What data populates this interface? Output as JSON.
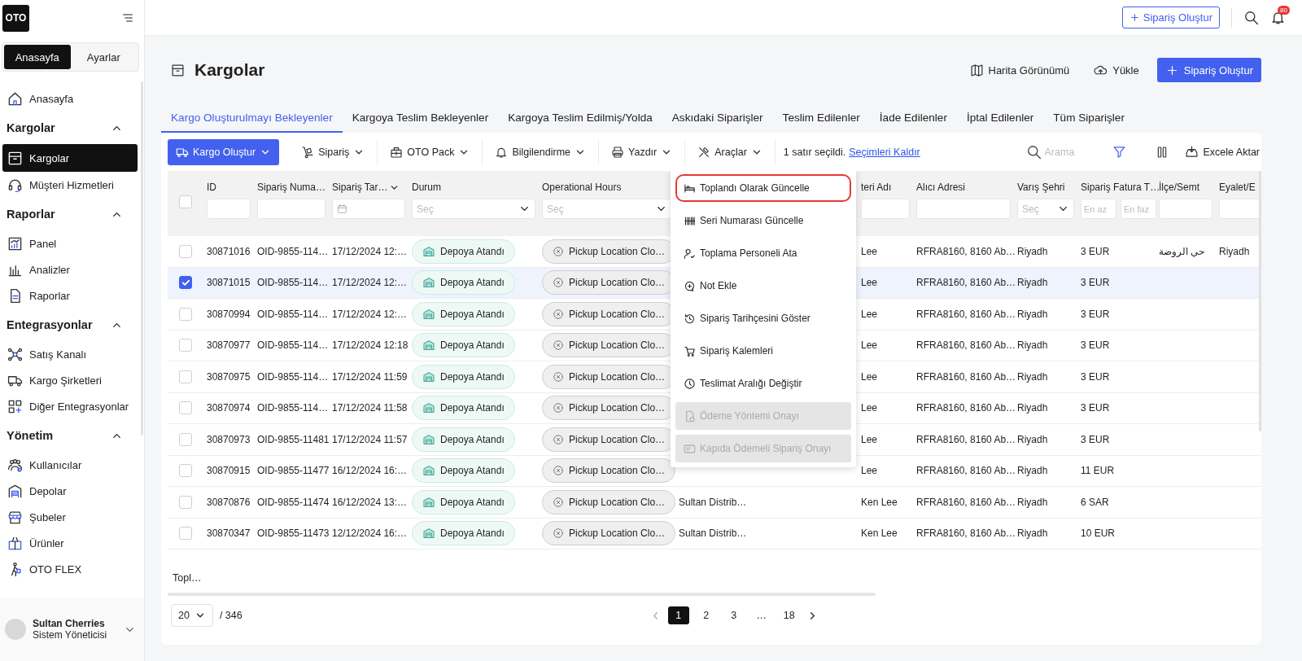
{
  "sidebar": {
    "logo": "OTO",
    "tabs": [
      {
        "label": "Anasayfa",
        "selected": true
      },
      {
        "label": "Ayarlar",
        "selected": false
      }
    ],
    "nav": [
      {
        "kind": "item",
        "label": "Anasayfa",
        "selected": false
      },
      {
        "kind": "group",
        "label": "Kargolar",
        "expanded": true,
        "children": [
          {
            "label": "Kargolar",
            "selected": true
          },
          {
            "label": "Müşteri Hizmetleri",
            "selected": false
          }
        ]
      },
      {
        "kind": "group",
        "label": "Raporlar",
        "expanded": true,
        "children": [
          {
            "label": "Panel",
            "selected": false
          },
          {
            "label": "Analizler",
            "selected": false
          },
          {
            "label": "Raporlar",
            "selected": false
          }
        ]
      },
      {
        "kind": "group",
        "label": "Entegrasyonlar",
        "expanded": true,
        "children": [
          {
            "label": "Satış Kanalı",
            "selected": false
          },
          {
            "label": "Kargo Şirketleri",
            "selected": false
          },
          {
            "label": "Diğer Entegrasyonlar",
            "selected": false
          }
        ]
      },
      {
        "kind": "group",
        "label": "Yönetim",
        "expanded": true,
        "children": [
          {
            "label": "Kullanıcılar",
            "selected": false
          },
          {
            "label": "Depolar",
            "selected": false
          },
          {
            "label": "Şubeler",
            "selected": false
          },
          {
            "label": "Ürünler",
            "selected": false
          },
          {
            "label": "OTO FLEX",
            "selected": false
          }
        ]
      }
    ],
    "user": {
      "name": "Sultan Cherries",
      "role": "Sistem Yöneticisi"
    }
  },
  "topbar": {
    "create_button": "Sipariş Oluştur",
    "notification_count": "80"
  },
  "page": {
    "title": "Kargolar",
    "actions": [
      {
        "kind": "link",
        "label": "Harita Görünümü"
      },
      {
        "kind": "link",
        "label": "Yükle"
      },
      {
        "kind": "primary",
        "label": "Sipariş Oluştur"
      }
    ]
  },
  "tabs": [
    {
      "label": "Kargo Oluşturulmayı Bekleyenler",
      "selected": true
    },
    {
      "label": "Kargoya Teslim Bekleyenler",
      "selected": false
    },
    {
      "label": "Kargoya Teslim Edilmiş/Yolda",
      "selected": false
    },
    {
      "label": "Askıdaki Siparişler",
      "selected": false
    },
    {
      "label": "Teslim Edilenler",
      "selected": false
    },
    {
      "label": "İade Edilenler",
      "selected": false
    },
    {
      "label": "İptal Edilenler",
      "selected": false
    },
    {
      "label": "Tüm Siparişler",
      "selected": false
    }
  ],
  "toolbar": {
    "menus": [
      {
        "kind": "primary",
        "label": "Kargo Oluştur"
      },
      {
        "kind": "plain",
        "label": "Sipariş"
      },
      {
        "kind": "plain",
        "label": "OTO Pack"
      },
      {
        "kind": "plain",
        "label": "Bilgilendirme"
      },
      {
        "kind": "plain",
        "label": "Yazdır"
      },
      {
        "kind": "plain",
        "label": "Araçlar"
      }
    ],
    "selection_info": "1 satır seçildi.",
    "clear_link": "Seçimleri Kaldır",
    "search": {
      "placeholder": "Arama"
    },
    "export_button": "Excele Aktar"
  },
  "actions_menu": {
    "items": [
      {
        "label": "Toplandı Olarak Güncelle",
        "highlighted": true,
        "disabled": false
      },
      {
        "label": "Seri Numarası Güncelle",
        "highlighted": false,
        "disabled": false
      },
      {
        "label": "Toplama Personeli Ata",
        "highlighted": false,
        "disabled": false
      },
      {
        "label": "Not Ekle",
        "highlighted": false,
        "disabled": false
      },
      {
        "label": "Sipariş Tarihçesini Göster",
        "highlighted": false,
        "disabled": false
      },
      {
        "label": "Sipariş Kalemleri",
        "highlighted": false,
        "disabled": false
      },
      {
        "label": "Teslimat Aralığı Değiştir",
        "highlighted": false,
        "disabled": false
      },
      {
        "label": "Ödeme Yöntemi Onayı",
        "highlighted": false,
        "disabled": true
      },
      {
        "label": "Kapıda Ödemeli Sipariş Onayı",
        "highlighted": false,
        "disabled": true
      }
    ]
  },
  "table": {
    "select_all": {
      "checked": false
    },
    "columns": [
      {
        "label": "ID",
        "kind": "input"
      },
      {
        "label": "Sipariş Numa…",
        "kind": "input"
      },
      {
        "label": "Sipariş Tar…",
        "kind": "date"
      },
      {
        "label": "Durum",
        "kind": "select",
        "placeholder": "Seç"
      },
      {
        "label": "Operational Hours",
        "kind": "select",
        "placeholder": "Seç"
      },
      {
        "kind": "blank"
      },
      {
        "label": "teri Adı",
        "kind": "input"
      },
      {
        "label": "Alıcı Adresi",
        "kind": "input"
      },
      {
        "label": "Varış Şehri",
        "kind": "select",
        "placeholder": "Seç"
      },
      {
        "label": "Sipariş Fatura T…",
        "kind": "range",
        "placeholder": "En az",
        "placeholder_max": "En faz"
      },
      {
        "label": "İlçe/Semt",
        "kind": "input"
      },
      {
        "label": "Eyalet/E",
        "kind": "input"
      }
    ],
    "rows": [
      {
        "selected": false,
        "id": "30871016",
        "order": "OID-9855-114…",
        "date": "17/12/2024 12:…",
        "status": "Depoya Atandı",
        "hours": "Pickup Location Clo…",
        "customer": "Lee",
        "address": "RFRA8160, 8160 Ab…",
        "city": "Riyadh",
        "invoice": "3 EUR",
        "district": "حي الروضة",
        "state": "Riyadh"
      },
      {
        "selected": true,
        "id": "30871015",
        "order": "OID-9855-114…",
        "date": "17/12/2024 12:…",
        "status": "Depoya Atandı",
        "hours": "Pickup Location Clo…",
        "customer": "Lee",
        "address": "RFRA8160, 8160 Ab…",
        "city": "Riyadh",
        "invoice": "3 EUR"
      },
      {
        "selected": false,
        "id": "30870994",
        "order": "OID-9855-114…",
        "date": "17/12/2024 12:…",
        "status": "Depoya Atandı",
        "hours": "Pickup Location Clo…",
        "customer": "Lee",
        "address": "RFRA8160, 8160 Ab…",
        "city": "Riyadh",
        "invoice": "3 EUR"
      },
      {
        "selected": false,
        "id": "30870977",
        "order": "OID-9855-114…",
        "date": "17/12/2024 12:18",
        "status": "Depoya Atandı",
        "hours": "Pickup Location Clo…",
        "customer": "Lee",
        "address": "RFRA8160, 8160 Ab…",
        "city": "Riyadh",
        "invoice": "3 EUR"
      },
      {
        "selected": false,
        "id": "30870975",
        "order": "OID-9855-114…",
        "date": "17/12/2024 11:59",
        "status": "Depoya Atandı",
        "hours": "Pickup Location Clo…",
        "customer": "Lee",
        "address": "RFRA8160, 8160 Ab…",
        "city": "Riyadh",
        "invoice": "3 EUR"
      },
      {
        "selected": false,
        "id": "30870974",
        "order": "OID-9855-114…",
        "date": "17/12/2024 11:58",
        "status": "Depoya Atandı",
        "hours": "Pickup Location Clo…",
        "customer": "Lee",
        "address": "RFRA8160, 8160 Ab…",
        "city": "Riyadh",
        "invoice": "3 EUR"
      },
      {
        "selected": false,
        "id": "30870973",
        "order": "OID-9855-11481",
        "date": "17/12/2024 11:57",
        "status": "Depoya Atandı",
        "hours": "Pickup Location Clo…",
        "customer": "Lee",
        "address": "RFRA8160, 8160 Ab…",
        "city": "Riyadh",
        "invoice": "3 EUR"
      },
      {
        "selected": false,
        "id": "30870915",
        "order": "OID-9855-11477",
        "date": "16/12/2024 16:…",
        "status": "Depoya Atandı",
        "hours": "Pickup Location Clo…",
        "customer": "Lee",
        "address": "RFRA8160, 8160 Ab…",
        "city": "Riyadh",
        "invoice": "11 EUR"
      },
      {
        "selected": false,
        "id": "30870876",
        "order": "OID-9855-11474",
        "date": "16/12/2024 13:…",
        "status": "Depoya Atandı",
        "hours": "Pickup Location Clo…",
        "column_6": "Sultan Distrib…",
        "customer": "Ken Lee",
        "address": "RFRA8160, 8160 Ab…",
        "city": "Riyadh",
        "invoice": "6 SAR"
      },
      {
        "selected": false,
        "id": "30870347",
        "order": "OID-9855-11473",
        "date": "12/12/2024 16:…",
        "status": "Depoya Atandı",
        "hours": "Pickup Location Clo…",
        "column_6": "Sultan Distrib…",
        "customer": "Ken Lee",
        "address": "RFRA8160, 8160 Ab…",
        "city": "Riyadh",
        "invoice": "10 EUR"
      }
    ]
  },
  "footer": {
    "summary": "Topl…",
    "page_size": "20",
    "total": "/ 346",
    "pages": [
      {
        "label": "1",
        "selected": true
      },
      {
        "label": "2",
        "selected": false
      },
      {
        "label": "3",
        "selected": false
      },
      {
        "label": "…",
        "selected": false
      },
      {
        "label": "18",
        "selected": false
      }
    ]
  }
}
